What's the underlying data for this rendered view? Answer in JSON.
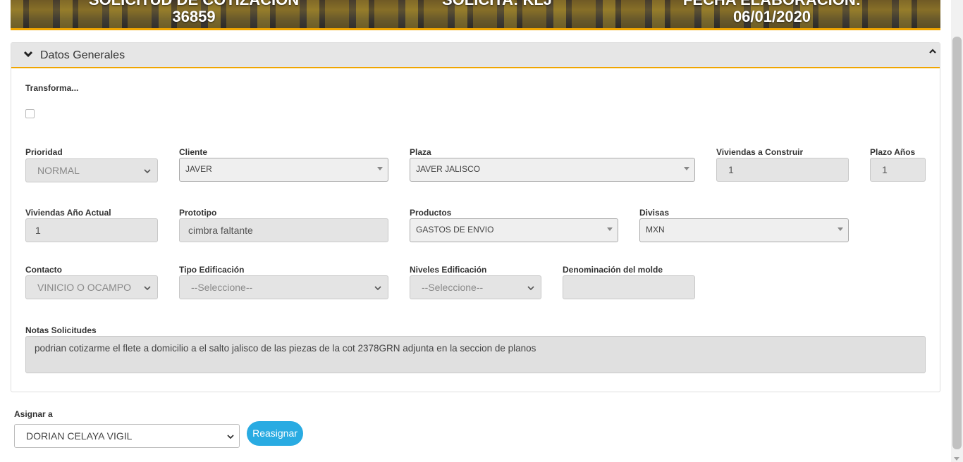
{
  "header": {
    "col1_title": "SOLICITUD DE COTIZACIÓN",
    "col1_value": "36859",
    "col2_title": "SOLICITA: KLJ",
    "col3_title": "FECHA ELABORACIÓN:",
    "col3_value": "06/01/2020"
  },
  "panel": {
    "title": "Datos Generales",
    "transforma_label": "Transforma...",
    "transforma_checked": false
  },
  "fields": {
    "prioridad": {
      "label": "Prioridad",
      "value": "NORMAL"
    },
    "cliente": {
      "label": "Cliente",
      "value": "JAVER"
    },
    "plaza": {
      "label": "Plaza",
      "value": "JAVER JALISCO"
    },
    "viviendas_construir": {
      "label": "Viviendas a Construir",
      "value": "1"
    },
    "plazo_anos": {
      "label": "Plazo Años",
      "value": "1"
    },
    "viviendas_ano_actual": {
      "label": "Viviendas Año Actual",
      "value": "1"
    },
    "prototipo": {
      "label": "Prototipo",
      "value": "cimbra faltante"
    },
    "productos": {
      "label": "Productos",
      "value": "GASTOS DE ENVIO"
    },
    "divisas": {
      "label": "Divisas",
      "value": "MXN"
    },
    "contacto": {
      "label": "Contacto",
      "value": "VINICIO O OCAMPO"
    },
    "tipo_edificacion": {
      "label": "Tipo Edificación",
      "value": "--Seleccione--"
    },
    "niveles_edificacion": {
      "label": "Niveles Edificación",
      "value": "--Seleccione--"
    },
    "denominacion_molde": {
      "label": "Denominación del molde",
      "value": ""
    },
    "notas": {
      "label": "Notas Solicitudes",
      "value": "podrian cotizarme el flete a  domicilio  a  el salto jalisco  de las piezas de la cot 2378GRN adjunta en la seccion de planos"
    }
  },
  "assign": {
    "label": "Asignar a",
    "value": "DORIAN CELAYA VIGIL",
    "button_label": "Reasignar"
  },
  "colors": {
    "accent": "#f0a500",
    "button": "#29abe2"
  }
}
